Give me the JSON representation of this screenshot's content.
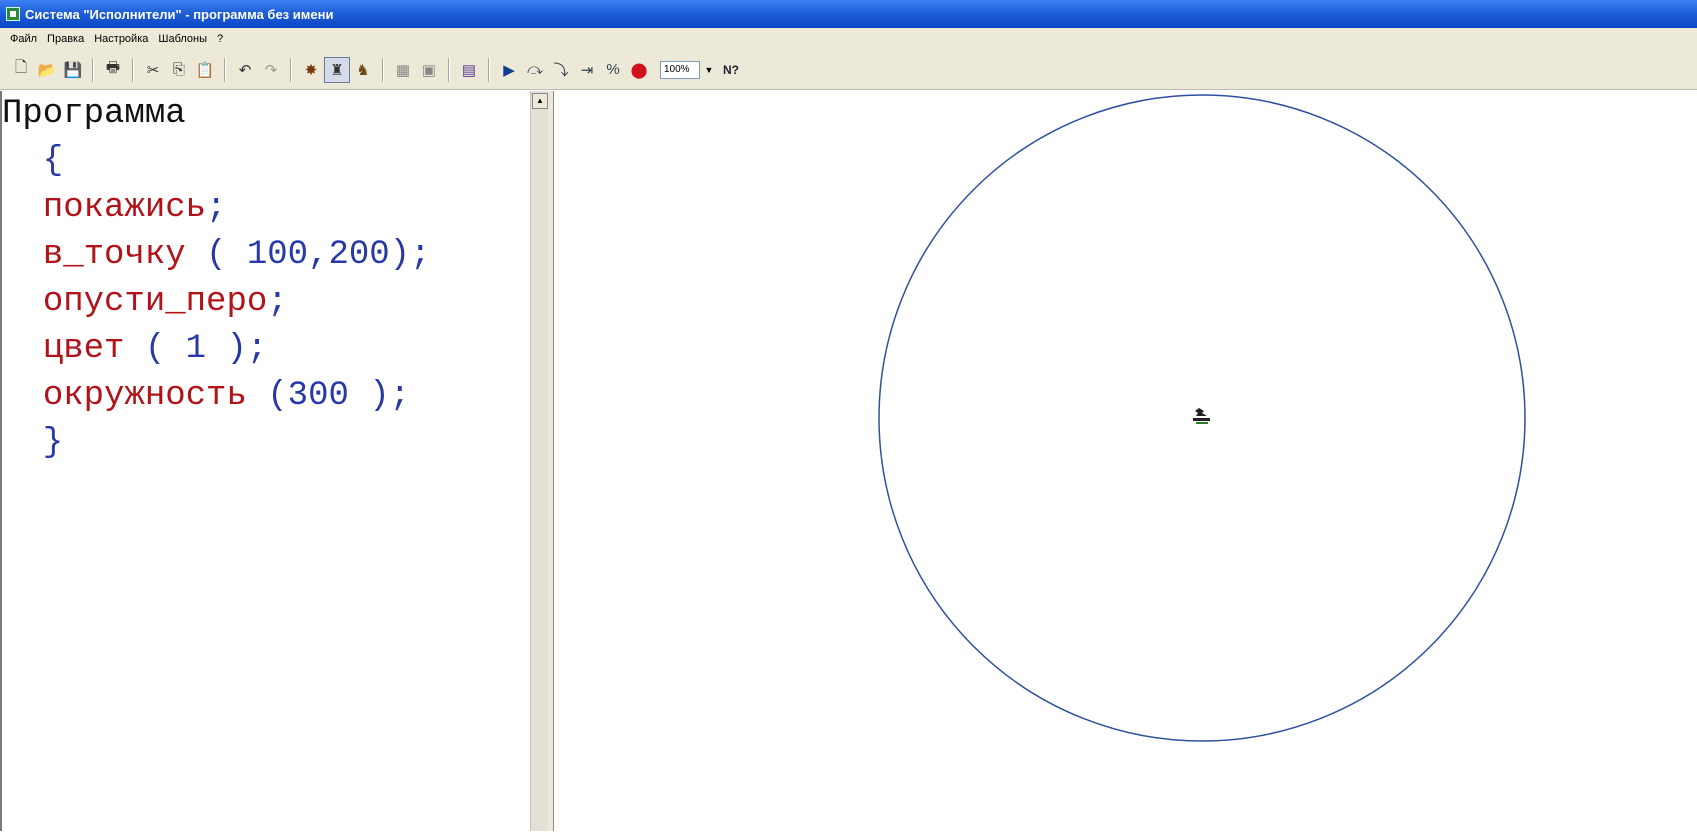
{
  "window": {
    "title": "Система \"Исполнители\" - программа без имени"
  },
  "menu": {
    "items": [
      "Файл",
      "Правка",
      "Настройка",
      "Шаблоны",
      "?"
    ]
  },
  "toolbar": {
    "buttons": [
      "new-icon",
      "open-icon",
      "save-icon",
      "print-icon",
      "cut-icon",
      "copy-icon",
      "paste-icon",
      "undo-icon",
      "redo-icon",
      "bug-icon",
      "turtle-icon",
      "executor-icon",
      "grid-icon",
      "grid2-icon",
      "step-icon",
      "run-icon",
      "step-over-icon",
      "step-into-icon",
      "breakpoint-icon",
      "percent-icon",
      "stop-icon"
    ],
    "zoom_value": "100%",
    "help_label": "N?"
  },
  "editor": {
    "lines": [
      {
        "parts": [
          {
            "t": "Программа",
            "c": "b"
          }
        ]
      },
      {
        "parts": [
          {
            "t": "  {",
            "c": "p"
          }
        ]
      },
      {
        "parts": [
          {
            "t": "  ",
            "c": "p"
          },
          {
            "t": "покажись",
            "c": "k"
          },
          {
            "t": ";",
            "c": "p"
          }
        ]
      },
      {
        "parts": [
          {
            "t": "  ",
            "c": "p"
          },
          {
            "t": "в_точку",
            "c": "k"
          },
          {
            "t": " ( 100,200);",
            "c": "p"
          }
        ]
      },
      {
        "parts": [
          {
            "t": "  ",
            "c": "p"
          },
          {
            "t": "опусти_перо",
            "c": "k"
          },
          {
            "t": ";",
            "c": "p"
          }
        ]
      },
      {
        "parts": [
          {
            "t": "  ",
            "c": "p"
          },
          {
            "t": "цвет",
            "c": "k"
          },
          {
            "t": " ( 1 );",
            "c": "p"
          }
        ]
      },
      {
        "parts": [
          {
            "t": "  ",
            "c": "p"
          },
          {
            "t": "окружность",
            "c": "k"
          },
          {
            "t": " (300 );",
            "c": "p"
          }
        ]
      },
      {
        "parts": [
          {
            "t": "  }",
            "c": "p"
          }
        ]
      }
    ]
  },
  "canvas": {
    "circle_color": "#2f4f9f",
    "executor_icon": "turtle-icon"
  },
  "colors": {
    "keyword": "#b0141a",
    "punctuation": "#2838a8"
  }
}
